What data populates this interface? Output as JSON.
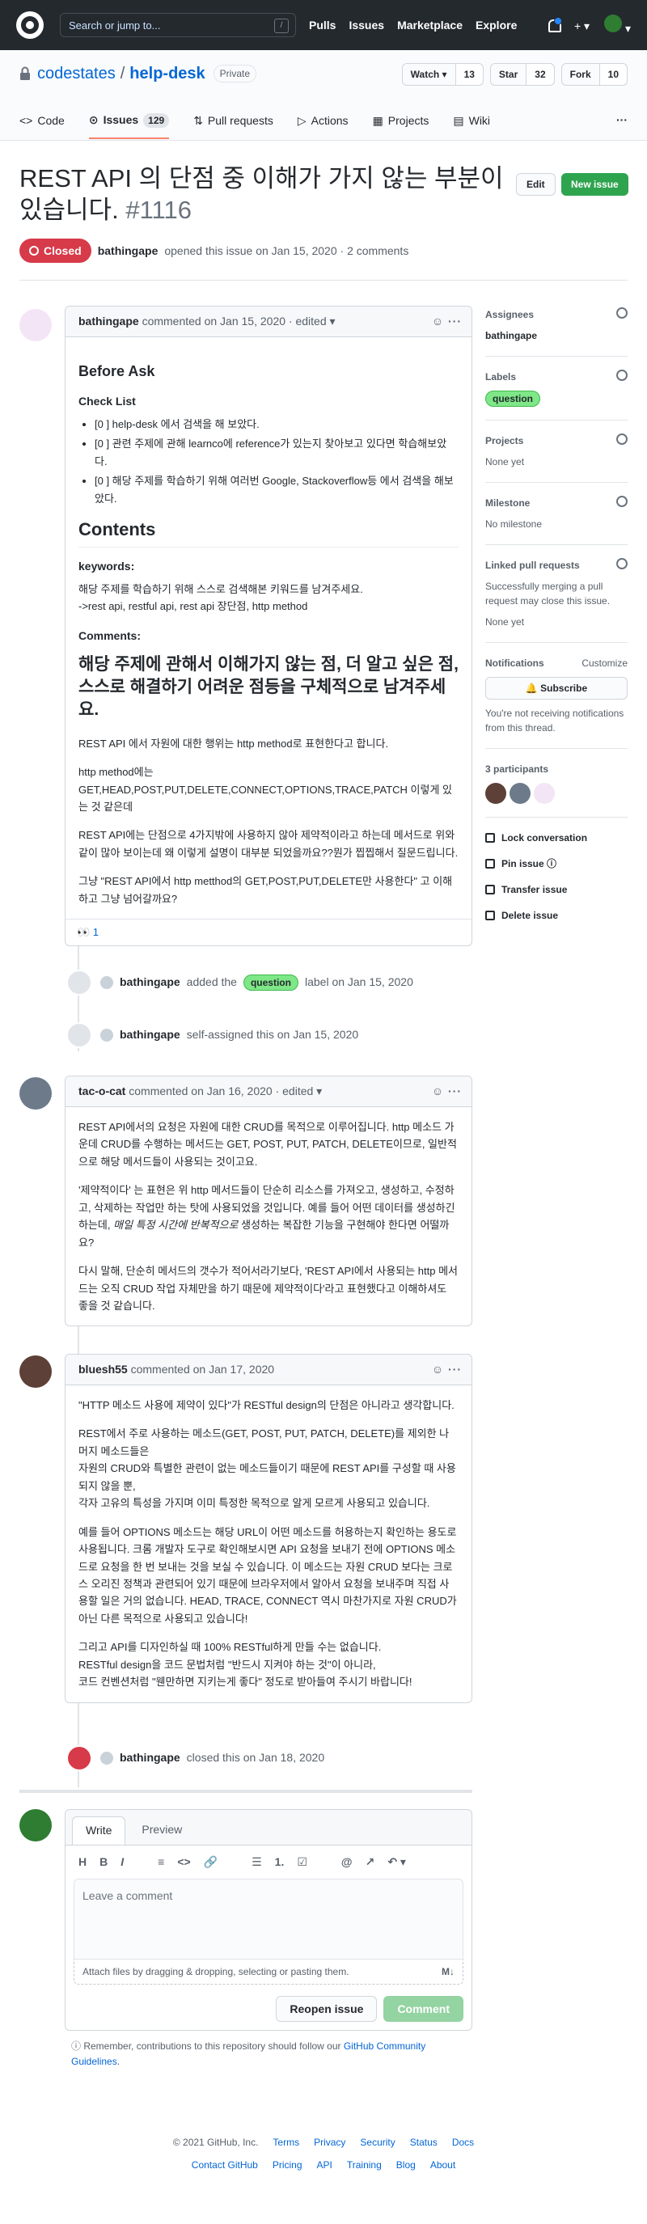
{
  "topbar": {
    "search_placeholder": "Search or jump to...",
    "search_shortcut": "/",
    "nav": [
      "Pulls",
      "Issues",
      "Marketplace",
      "Explore"
    ],
    "plus": "+ ▾",
    "avatar_caret": "▾"
  },
  "repo": {
    "owner": "codestates",
    "name": "help-desk",
    "visibility": "Private",
    "watch_label": "Watch ▾",
    "watch_count": "13",
    "star_label": "Star",
    "star_count": "32",
    "fork_label": "Fork",
    "fork_count": "10",
    "tabs": [
      {
        "label": "Code"
      },
      {
        "label": "Issues",
        "count": "129"
      },
      {
        "label": "Pull requests"
      },
      {
        "label": "Actions"
      },
      {
        "label": "Projects"
      },
      {
        "label": "Wiki"
      }
    ],
    "more": "···"
  },
  "issue": {
    "title": "REST API 의 단점 중 이해가 가지 않는 부분이 있습니다.",
    "number": "#1116",
    "edit_label": "Edit",
    "new_issue_label": "New issue",
    "state": "Closed",
    "author": "bathingape",
    "opened_text": "opened this issue on Jan 15, 2020 · 2 comments"
  },
  "comments": [
    {
      "author": "bathingape",
      "meta": "commented on Jan 15, 2020 · edited ▾",
      "before_ask": "Before Ask",
      "check_list": "Check List",
      "checks": [
        "[0 ] help-desk 에서 검색을 해 보았다.",
        "[0 ] 관련 주제에 관해 learnco에 reference가 있는지 찾아보고 있다면 학습해보았다.",
        "[0 ] 해당 주제를 학습하기 위해 여러번 Google, Stackoverflow등 에서 검색을 해보았다."
      ],
      "contents": "Contents",
      "keywords_title": "keywords:",
      "keywords_desc": "해당 주제를 학습하기 위해 스스로 검색해본 키워드를 남겨주세요.",
      "keywords": "->rest api, restful api, rest api 장단점, http method",
      "comments_title": "Comments:",
      "comments_heading": "해당 주제에 관해서 이해가지 않는 점, 더 알고 싶은 점, 스스로 해결하기 어려운 점등을 구체적으로 남겨주세요.",
      "p1": "REST API 에서 자원에 대한 행위는 http method로 표현한다고 합니다.",
      "p2a": "http method에는",
      "p2b": "GET,HEAD,POST,PUT,DELETE,CONNECT,OPTIONS,TRACE,PATCH 이렇게 있는 것 같은데",
      "p3": "REST API에는 단점으로 4가지밖에 사용하지 않아 제약적이라고 하는데 메서드로 위와 같이 많아 보이는데 왜 이렇게 설명이 대부분 되었을까요??뭔가 찝찝해서 질문드립니다.",
      "p4": "그냥 \"REST API에서 http metthod의 GET,POST,PUT,DELETE만 사용한다\" 고 이해하고 그냥 넘어갈까요?",
      "reaction": "👀 1"
    },
    {
      "author": "tac-o-cat",
      "meta": "commented on Jan 16, 2020 · edited ▾",
      "p1": "REST API에서의 요청은 자원에 대한 CRUD를 목적으로 이루어집니다. http 메소드 가운데 CRUD를 수행하는 메서드는 GET, POST, PUT, PATCH, DELETE이므로, 일반적으로 해당 메서드들이 사용되는 것이고요.",
      "p2_pre": "'제약적이다' 는 표현은 위 http 메서드들이 단순히 리소스를 가져오고, 생성하고, 수정하고, 삭제하는 작업만 하는 탓에 사용되었을 것입니다. 예를 들어 어떤 데이터를 생성하긴 하는데, ",
      "p2_em": "매일 특정 시간에 반복적으로",
      "p2_post": " 생성하는 복잡한 기능을 구현해야 한다면 어떨까요?",
      "p3": "다시 말해, 단순히 메서드의 갯수가 적어서라기보다, 'REST API에서 사용되는 http 메서드는 오직 CRUD 작업 자체만을 하기 때문에 제약적이다'라고 표현했다고 이해하셔도 좋을 것 같습니다."
    },
    {
      "author": "bluesh55",
      "meta": "commented on Jan 17, 2020",
      "p1": "\"HTTP 메소드 사용에 제약이 있다\"가 RESTful design의 단점은 아니라고 생각합니다.",
      "p2a": "REST에서 주로 사용하는 메소드(GET, POST, PUT, PATCH, DELETE)를 제외한 나머지 메소드들은",
      "p2b": "자원의 CRUD와 특별한 관련이 없는 메소드들이기 때문에 REST API를 구성할 때 사용되지 않을 뿐,",
      "p2c": "각자 고유의 특성을 가지며 이미 특정한 목적으로 알게 모르게 사용되고 있습니다.",
      "p3": "예를 들어 OPTIONS 메소드는 해당 URL이 어떤 메소드를 허용하는지 확인하는 용도로 사용됩니다. 크롬 개발자 도구로 확인해보시면 API 요청을 보내기 전에 OPTIONS 메소드로 요청을 한 번 보내는 것을 보실 수 있습니다. 이 메소드는 자원 CRUD 보다는 크로스 오리진 정책과 관련되어 있기 때문에 브라우저에서 알아서 요청을 보내주며 직접 사용할 일은 거의 없습니다. HEAD, TRACE, CONNECT 역시 마찬가지로 자원 CRUD가 아닌 다른 목적으로 사용되고 있습니다!",
      "p4a": "그리고 API를 디자인하실 때 100% RESTful하게 만들 수는 없습니다.",
      "p4b": "RESTful design을 코드 문법처럼 \"반드시 지켜야 하는 것\"이 아니라,",
      "p4c": "코드 컨벤션처럼 \"웬만하면 지키는게 좋다\" 정도로 받아들여 주시기 바랍니다!"
    }
  ],
  "events": {
    "label_actor": "bathingape",
    "label_pre": "added the",
    "label_name": "question",
    "label_post": "label on Jan 15, 2020",
    "assign_actor": "bathingape",
    "assign_text": "self-assigned this on Jan 15, 2020",
    "close_actor": "bathingape",
    "close_text": "closed this on Jan 18, 2020"
  },
  "composer": {
    "tab_write": "Write",
    "tab_preview": "Preview",
    "toolbar": [
      "H",
      "B",
      "I",
      "≡",
      "<>",
      "🔗",
      "☰",
      "1.",
      "☑",
      "@",
      "↗",
      "↶ ▾"
    ],
    "placeholder": "Leave a comment",
    "attach_text": "Attach files by dragging & dropping, selecting or pasting them.",
    "md_icon": "M↓",
    "reopen_label": "Reopen issue",
    "comment_label": "Comment",
    "contrib_pre": "Remember, contributions to this repository should follow our ",
    "contrib_link": "GitHub Community Guidelines",
    "contrib_post": "."
  },
  "sidebar": {
    "assignees_title": "Assignees",
    "assignee": "bathingape",
    "labels_title": "Labels",
    "label": "question",
    "projects_title": "Projects",
    "projects_val": "None yet",
    "milestone_title": "Milestone",
    "milestone_val": "No milestone",
    "linked_title": "Linked pull requests",
    "linked_desc": "Successfully merging a pull request may close this issue.",
    "linked_val": "None yet",
    "notif_title": "Notifications",
    "notif_customize": "Customize",
    "subscribe_label": "🔔 Subscribe",
    "notif_desc": "You're not receiving notifications from this thread.",
    "participants_title": "3 participants",
    "lock": "Lock conversation",
    "pin": "Pin issue ⓘ",
    "transfer": "Transfer issue",
    "delete": "Delete issue"
  },
  "footer": {
    "copyright": "© 2021 GitHub, Inc.",
    "row1": [
      "Terms",
      "Privacy",
      "Security",
      "Status",
      "Docs"
    ],
    "row2": [
      "Contact GitHub",
      "Pricing",
      "API",
      "Training",
      "Blog",
      "About"
    ]
  },
  "colors": {
    "closed": "#d73a49",
    "green": "#2ea44f",
    "label": "#7ee787",
    "link": "#0366d6"
  }
}
